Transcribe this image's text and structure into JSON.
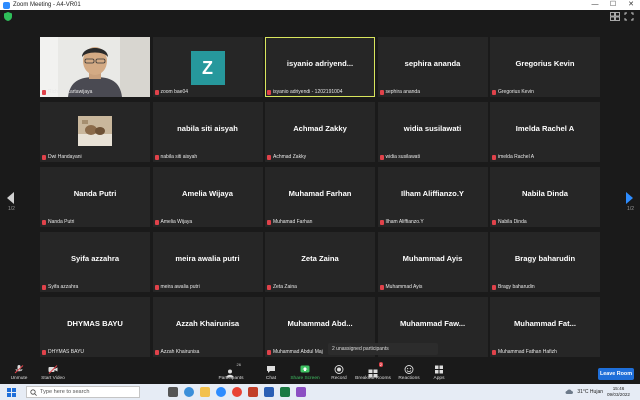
{
  "window": {
    "title": "Zoom Meeting - A4-VR01",
    "minimize_glyph": "—",
    "maximize_glyph": "☐",
    "close_glyph": "✕"
  },
  "grid": {
    "tiles": [
      {
        "big": "",
        "small": "Richard Kartawijaya",
        "kind": "photo"
      },
      {
        "big": "",
        "small": "zoom bae04",
        "kind": "avatar",
        "avatar_letter": "Z"
      },
      {
        "big": "isyanio  adriyend...",
        "small": "isyanio adriyendi - 1202191004",
        "kind": "name",
        "active": true
      },
      {
        "big": "sephira ananda",
        "small": "sephira ananda",
        "kind": "name"
      },
      {
        "big": "Gregorius Kevin",
        "small": "Gregorius Kevin",
        "kind": "name"
      },
      {
        "big": "",
        "small": "Dwi Handayani",
        "kind": "smallphoto"
      },
      {
        "big": "nabila siti aisyah",
        "small": "nabila siti aisyah",
        "kind": "name"
      },
      {
        "big": "Achmad Zakky",
        "small": "Achmad Zakky",
        "kind": "name"
      },
      {
        "big": "widia susilawati",
        "small": "widia susilawati",
        "kind": "name"
      },
      {
        "big": "Imelda Rachel A",
        "small": "imelda Rachel A",
        "kind": "name"
      },
      {
        "big": "Nanda Putri",
        "small": "Nanda Putri",
        "kind": "name"
      },
      {
        "big": "Amelia Wijaya",
        "small": "Amelia Wijaya",
        "kind": "name"
      },
      {
        "big": "Muhamad Farhan",
        "small": "Muhamad Farhan",
        "kind": "name"
      },
      {
        "big": "Ilham Aliffianzo.Y",
        "small": "Ilham Aliffianzo.Y",
        "kind": "name"
      },
      {
        "big": "Nabila Dinda",
        "small": "Nabila Dinda",
        "kind": "name"
      },
      {
        "big": "Syifa azzahra",
        "small": "Syifa azzahra",
        "kind": "name"
      },
      {
        "big": "meira awalia putri",
        "small": "meira awalia putri",
        "kind": "name"
      },
      {
        "big": "Zeta Zaina",
        "small": "Zeta Zaina",
        "kind": "name"
      },
      {
        "big": "Muhammad Ayis",
        "small": "Muhammad Ayis",
        "kind": "name"
      },
      {
        "big": "Bragy baharudin",
        "small": "Bragy baharudin",
        "kind": "name"
      },
      {
        "big": "DHYMAS BAYU",
        "small": "DHYMAS BAYU",
        "kind": "name"
      },
      {
        "big": "Azzah Khairunisa",
        "small": "Azzah Khairunisa",
        "kind": "name"
      },
      {
        "big": "Muhammad  Abd...",
        "small": "Muhammad Abdul Maj",
        "kind": "name"
      },
      {
        "big": "Muhammad  Faw...",
        "small": "za",
        "kind": "name"
      },
      {
        "big": "Muhammad  Fat...",
        "small": "Muhammad Fathan Hafizh",
        "kind": "name"
      }
    ]
  },
  "pager": {
    "left": "1/2",
    "right": "1/2"
  },
  "unassigned_text": "2 unassigned participants",
  "toolbar": {
    "unmute": "Unmute",
    "start_video": "Start Video",
    "participants": "Participants",
    "participants_count": "26",
    "chat": "Chat",
    "share": "Share Screen",
    "record": "Record",
    "breakout": "Breakout Rooms",
    "breakout_badge": "2",
    "reactions": "Reactions",
    "apps": "Apps",
    "leave": "Leave Room"
  },
  "taskbar": {
    "search_placeholder": "Type here to search",
    "weather": "31°C  Hujan",
    "time": "15:46",
    "date": "09/03/2022"
  },
  "colors": {
    "accent_blue": "#1f6fd9",
    "active_border": "#d8e55d",
    "mute_red": "#e0424a",
    "share_green": "#3fc163",
    "avatar_teal": "#26989c"
  }
}
